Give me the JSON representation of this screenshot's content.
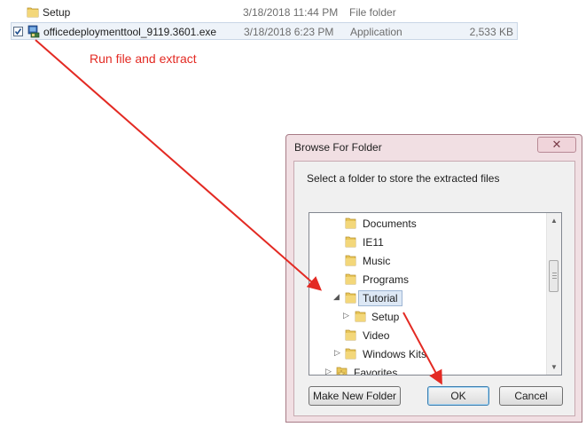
{
  "explorer": {
    "files": [
      {
        "name": "Setup",
        "date": "3/18/2018 11:44 PM",
        "type": "File folder",
        "size": "",
        "icon": "folder-icon",
        "checked": false
      },
      {
        "name": "officedeploymenttool_9119.3601.exe",
        "date": "3/18/2018 6:23 PM",
        "type": "Application",
        "size": "2,533 KB",
        "icon": "installer-icon",
        "checked": true
      }
    ]
  },
  "annotation": {
    "text": "Run file and extract",
    "color": "#e32a23"
  },
  "dialog": {
    "title": "Browse For Folder",
    "close_symbol": "✕",
    "description": "Select a folder to store the extracted files",
    "tree": [
      {
        "label": "Documents",
        "expander": "",
        "selected": false
      },
      {
        "label": "IE11",
        "expander": "",
        "selected": false
      },
      {
        "label": "Music",
        "expander": "",
        "selected": false
      },
      {
        "label": "Programs",
        "expander": "",
        "selected": false
      },
      {
        "label": "Tutorial",
        "expander": "◢",
        "selected": true
      },
      {
        "label": "Setup",
        "expander": "▷",
        "selected": false
      },
      {
        "label": "Video",
        "expander": "",
        "selected": false
      },
      {
        "label": "Windows Kits",
        "expander": "▷",
        "selected": false
      },
      {
        "label": "Favorites",
        "expander": "▷",
        "selected": false
      }
    ],
    "buttons": {
      "new_folder": "Make New Folder",
      "ok": "OK",
      "cancel": "Cancel"
    }
  },
  "colors": {
    "folder": "#e8c65a",
    "arrow": "#e32a23",
    "dialog_frame": "#f1dfe3"
  }
}
